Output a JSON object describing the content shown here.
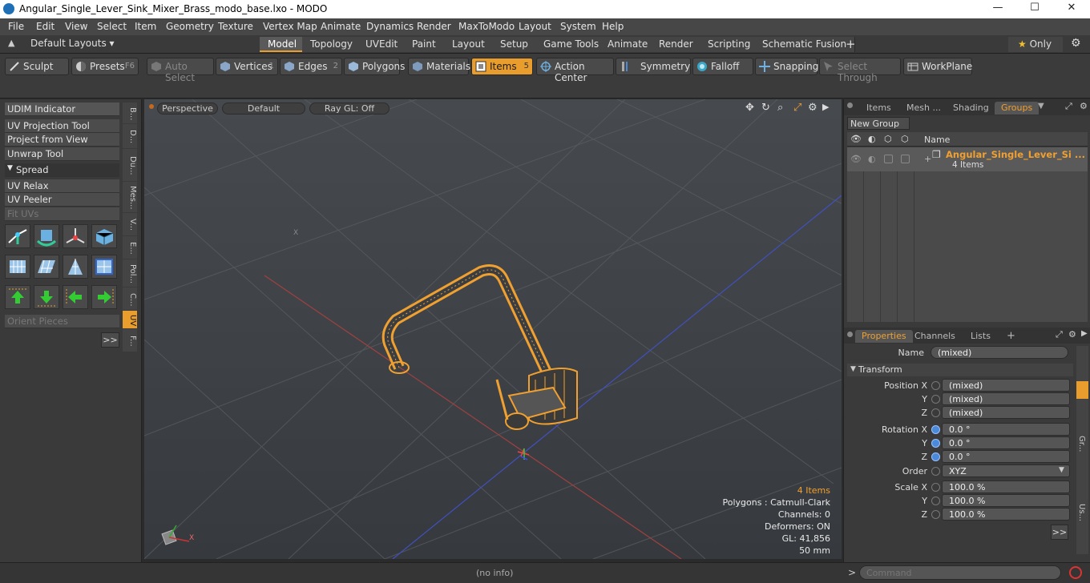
{
  "window": {
    "title": "Angular_Single_Lever_Sink_Mixer_Brass_modo_base.lxo - MODO",
    "minimize": "—",
    "maximize": "☐",
    "close": "✕"
  },
  "menu": [
    "File",
    "Edit",
    "View",
    "Select",
    "Item",
    "Geometry",
    "Texture",
    "Vertex Map",
    "Animate",
    "Dynamics",
    "Render",
    "MaxToModo",
    "Layout",
    "System",
    "Help"
  ],
  "layouts": {
    "label": "Default Layouts ▾",
    "only": "Only"
  },
  "tabs": [
    "Model",
    "Topology",
    "UVEdit",
    "Paint",
    "Layout",
    "Setup",
    "Game Tools",
    "Animate",
    "Render",
    "Scripting",
    "Schematic Fusion",
    "+"
  ],
  "toolbar": {
    "sculpt": "Sculpt",
    "presets": "Presets",
    "presets_key": "F6",
    "auto_select": "Auto Select",
    "vertices": "Vertices",
    "vertices_num": "1",
    "edges": "Edges",
    "edges_num": "2",
    "polygons": "Polygons",
    "materials": "Materials",
    "items": "Items",
    "items_num": "5",
    "action_center": "Action Center",
    "symmetry": "Symmetry",
    "falloff": "Falloff",
    "snapping": "Snapping",
    "select_through": "Select Through",
    "workplane": "WorkPlane"
  },
  "left_panel": {
    "buttons": [
      "UDIM Indicator",
      "UV Projection Tool",
      "Project from View",
      "Unwrap Tool",
      "Spread",
      "UV Relax",
      "UV Peeler",
      "Fit UVs",
      "Orient Pieces"
    ],
    "more": ">>",
    "vtabs": [
      "B...",
      "D...",
      "Du...",
      "Mes...",
      "V...",
      "E...",
      "Pol...",
      "C...",
      "UV",
      "F..."
    ]
  },
  "viewport": {
    "perspective": "Perspective",
    "default": "Default",
    "raygl": "Ray GL: Off",
    "info": [
      "4 Items",
      "Polygons : Catmull-Clark",
      "Channels: 0",
      "Deformers: ON",
      "GL: 41,856",
      "50 mm"
    ],
    "axis_x": "X",
    "axis_label": "X"
  },
  "right_top": {
    "tabs": [
      "Items",
      "Mesh ...",
      "Shading",
      "Groups"
    ],
    "new_group": "New Group",
    "name_header": "Name",
    "group_name": "Angular_Single_Lever_Si ...",
    "group_count": "4 Items"
  },
  "properties": {
    "tabs": [
      "Properties",
      "Channels",
      "Lists",
      "+"
    ],
    "name_label": "Name",
    "name_value": "(mixed)",
    "transform": "Transform",
    "position_label": "Position X",
    "pos_x": "(mixed)",
    "pos_y": "(mixed)",
    "pos_z": "(mixed)",
    "rotation_label": "Rotation X",
    "rot_x": "0.0 °",
    "rot_y": "0.0 °",
    "rot_z": "0.0 °",
    "order_label": "Order",
    "order_value": "XYZ",
    "scale_label": "Scale X",
    "scale_x": "100.0 %",
    "scale_y": "100.0 %",
    "scale_z": "100.0 %",
    "y": "Y",
    "z": "Z",
    "more": ">>",
    "side_tabs": [
      "Gr...",
      "Us..."
    ]
  },
  "status": {
    "info": "(no info)",
    "command_placeholder": "Command",
    "prompt": ">"
  },
  "colors": {
    "accent": "#e89d2c",
    "viewport_bg": "#42464a",
    "mesh": "#f0a030"
  }
}
